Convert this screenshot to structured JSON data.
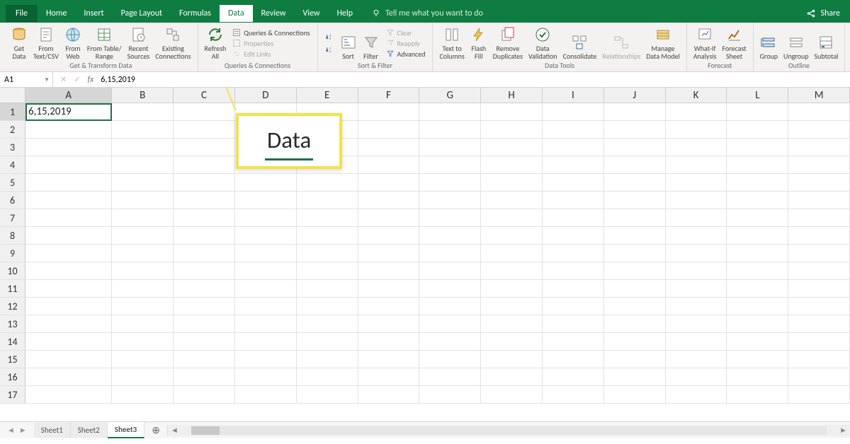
{
  "tabs": {
    "file": "File",
    "home": "Home",
    "insert": "Insert",
    "page_layout": "Page Layout",
    "formulas": "Formulas",
    "data": "Data",
    "review": "Review",
    "view": "View",
    "help": "Help",
    "tell_me": "Tell me what you want to do"
  },
  "share": "Share",
  "ribbon": {
    "get_data": "Get\nData",
    "from_text": "From\nText/CSV",
    "from_web": "From\nWeb",
    "from_table": "From Table/\nRange",
    "recent": "Recent\nSources",
    "existing": "Existing\nConnections",
    "group1": "Get & Transform Data",
    "refresh": "Refresh\nAll",
    "queries": "Queries & Connections",
    "properties": "Properties",
    "edit_links": "Edit Links",
    "group2": "Queries & Connections",
    "sort": "Sort",
    "filter": "Filter",
    "clear": "Clear",
    "reapply": "Reapply",
    "advanced": "Advanced",
    "group3": "Sort & Filter",
    "text_cols": "Text to\nColumns",
    "flash": "Flash\nFill",
    "remove_dup": "Remove\nDuplicates",
    "validation": "Data\nValidation",
    "consolidate": "Consolidate",
    "relationships": "Relationships",
    "manage": "Manage\nData Model",
    "group4": "Data Tools",
    "whatif": "What-If\nAnalysis",
    "forecast": "Forecast\nSheet",
    "group5": "Forecast",
    "group": "Group",
    "ungroup": "Ungroup",
    "subtotal": "Subtotal",
    "group6": "Outline"
  },
  "formula_bar": {
    "name_box": "A1",
    "fx": "fx",
    "content": "6,15,2019"
  },
  "columns": [
    "A",
    "B",
    "C",
    "D",
    "E",
    "F",
    "G",
    "H",
    "I",
    "J",
    "K",
    "L",
    "M"
  ],
  "rows": [
    "1",
    "2",
    "3",
    "4",
    "5",
    "6",
    "7",
    "8",
    "9",
    "10",
    "11",
    "12",
    "13",
    "14",
    "15",
    "16",
    "17"
  ],
  "cell_a1": "6,15,2019",
  "callout": "Data",
  "sheets": {
    "s1": "Sheet1",
    "s2": "Sheet2",
    "s3": "Sheet3"
  }
}
